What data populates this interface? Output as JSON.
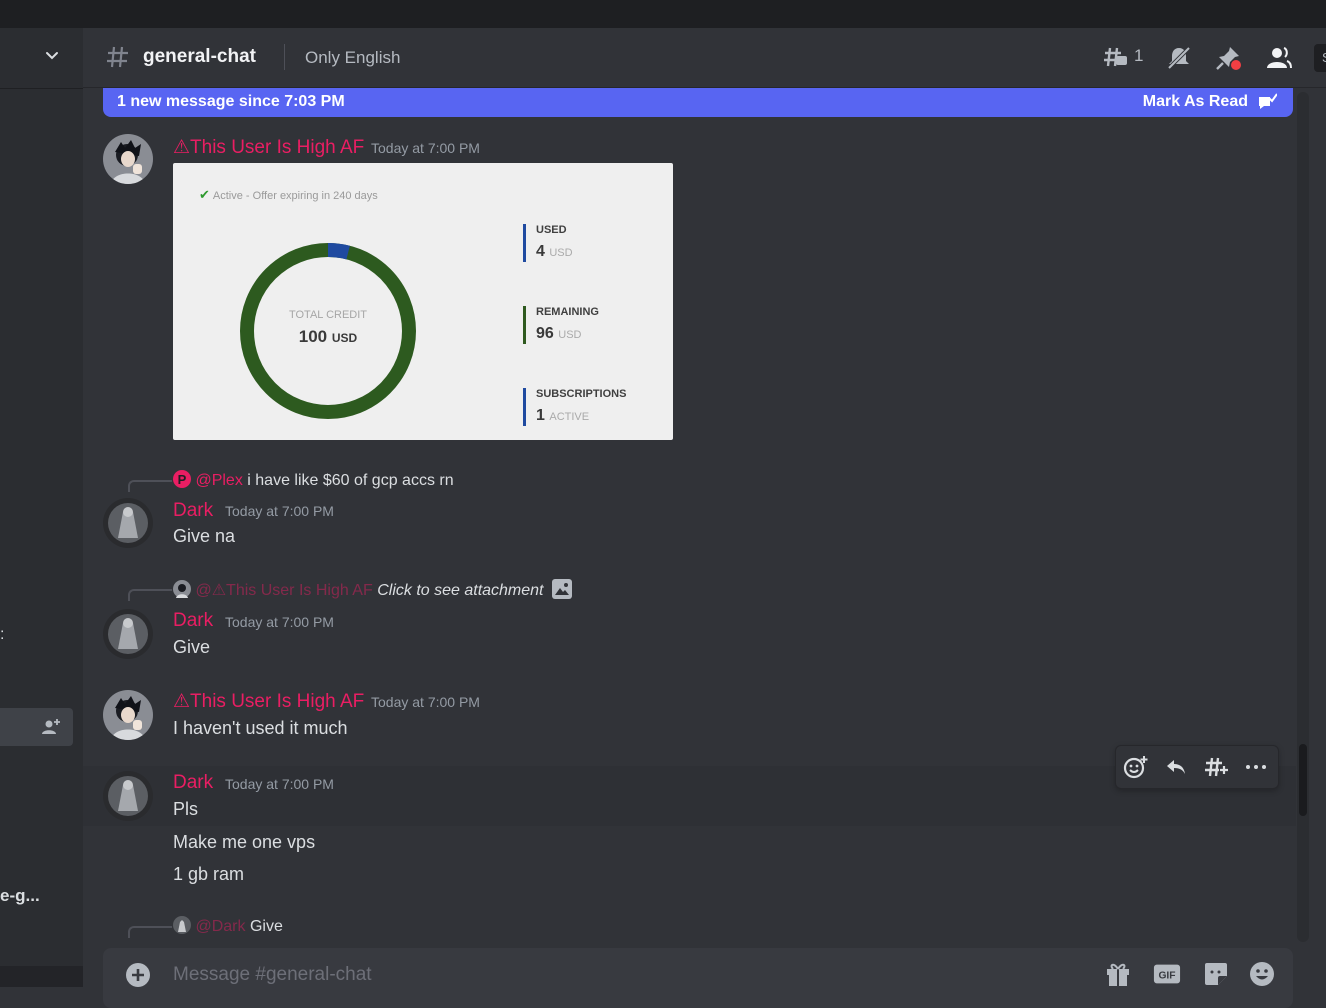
{
  "sidebar": {
    "fragment_1": ":",
    "fragment_2": "e-g...",
    "add_member_icon": "person-add-icon"
  },
  "header": {
    "channel_name": "general-chat",
    "topic": "Only English",
    "thread_count": "1",
    "search_fragment": "S"
  },
  "new_messages_bar": {
    "text": "1 new message since 7:03 PM",
    "mark_read": "Mark As Read"
  },
  "messages": [
    {
      "author": "⚠This User Is High AF",
      "timestamp": "Today at 7:00 PM",
      "attachment": {
        "status": "Active - Offer expiring in 240 days",
        "total_label": "TOTAL CREDIT",
        "total_value": "100",
        "total_unit": "USD",
        "used_label": "USED",
        "used_value": "4",
        "used_unit": "USD",
        "remaining_label": "REMAINING",
        "remaining_value": "96",
        "remaining_unit": "USD",
        "subs_label": "SUBSCRIPTIONS",
        "subs_value": "1",
        "subs_unit": "ACTIVE",
        "used_fraction": 0.04
      }
    },
    {
      "reply_mention": "@Plex",
      "reply_text": "i have like $60 of gcp accs rn",
      "author": "Dark",
      "timestamp": "Today at 7:00 PM",
      "lines": [
        "Give na"
      ]
    },
    {
      "reply_mention": "@⚠This User Is High AF",
      "reply_text": "Click to see attachment",
      "author": "Dark",
      "timestamp": "Today at 7:00 PM",
      "lines": [
        "Give"
      ]
    },
    {
      "author": "⚠This User Is High AF",
      "timestamp": "Today at 7:00 PM",
      "lines": [
        "I haven't used it much"
      ]
    },
    {
      "author": "Dark",
      "timestamp": "Today at 7:00 PM",
      "lines": [
        "Pls",
        "Make me one vps",
        "1 gb ram"
      ]
    },
    {
      "reply_mention": "@Dark",
      "reply_text": "Give"
    }
  ],
  "composer": {
    "placeholder": "Message #general-chat",
    "gif_label": "GIF"
  },
  "colors": {
    "accent": "#5865f2",
    "author_pink": "#e91e63",
    "background": "#313338"
  }
}
